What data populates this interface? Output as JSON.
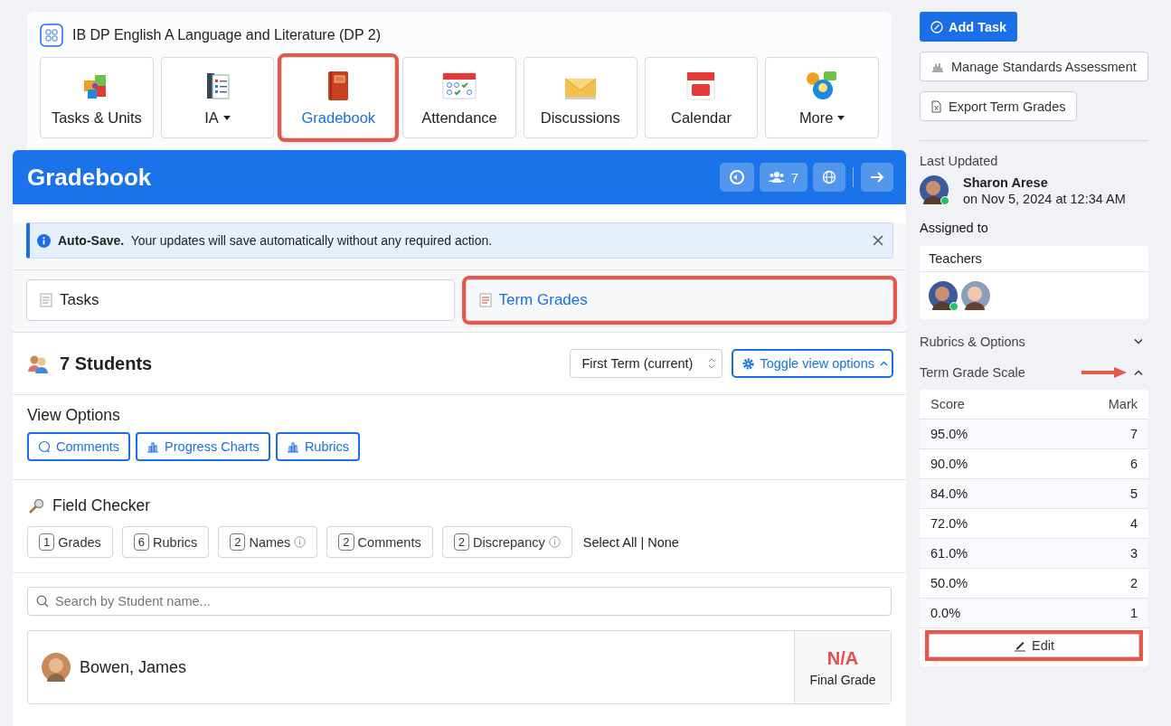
{
  "course": {
    "title": "IB DP English A Language and Literature (DP 2)"
  },
  "nav": [
    {
      "label": "Tasks & Units",
      "selected": false,
      "dropdown": false,
      "highlighted": false
    },
    {
      "label": "IA",
      "selected": false,
      "dropdown": true,
      "highlighted": false
    },
    {
      "label": "Gradebook",
      "selected": true,
      "dropdown": false,
      "highlighted": true
    },
    {
      "label": "Attendance",
      "selected": false,
      "dropdown": false,
      "highlighted": false
    },
    {
      "label": "Discussions",
      "selected": false,
      "dropdown": false,
      "highlighted": false
    },
    {
      "label": "Calendar",
      "selected": false,
      "dropdown": false,
      "highlighted": false
    },
    {
      "label": "More",
      "selected": false,
      "dropdown": true,
      "highlighted": false
    }
  ],
  "gradebook": {
    "title": "Gradebook",
    "member_count": "7",
    "notice": {
      "text": "**Auto-Save.**  Your updates will save automatically without any required action."
    },
    "tabs": [
      {
        "label": "Tasks",
        "selected": false,
        "highlighted": false
      },
      {
        "label": "Term Grades",
        "selected": true,
        "highlighted": true
      }
    ],
    "students_heading": "7 Students",
    "term_select": {
      "value": "First Term (current)"
    },
    "toggle_button": "Toggle view options",
    "view_options": {
      "heading": "View Options",
      "buttons": [
        "Comments",
        "Progress Charts",
        "Rubrics"
      ]
    },
    "field_checker": {
      "heading": "Field Checker",
      "chips": [
        {
          "count": "1",
          "label": "Grades",
          "info": false
        },
        {
          "count": "6",
          "label": "Rubrics",
          "info": false
        },
        {
          "count": "2",
          "label": "Names",
          "info": true
        },
        {
          "count": "2",
          "label": "Comments",
          "info": false
        },
        {
          "count": "2",
          "label": "Discrepancy",
          "info": true
        }
      ],
      "select_all": "Select All",
      "separator": "|",
      "none": "None"
    },
    "search": {
      "placeholder": "Search by Student name..."
    },
    "student": {
      "name": "Bowen, James",
      "grade": "N/A",
      "grade_label": "Final Grade"
    }
  },
  "sidebar": {
    "buttons": [
      "Add Task",
      "Manage Standards Assessment",
      "Export Term Grades"
    ],
    "last_updated": {
      "heading": "Last Updated",
      "name": "Sharon Arese",
      "date": "on Nov 5, 2024 at 12:34 AM",
      "online": true
    },
    "assigned": {
      "heading": "Assigned to",
      "group": "Teachers",
      "teachers": [
        {
          "online": true
        },
        {
          "online": false
        }
      ]
    },
    "sections": [
      {
        "title": "Rubrics & Options",
        "expanded": false,
        "pointed": false
      },
      {
        "title": "Term Grade Scale",
        "expanded": true,
        "pointed": true
      }
    ],
    "scale": {
      "columns": [
        "Score",
        "Mark"
      ],
      "rows": [
        [
          "95.0%",
          "7"
        ],
        [
          "90.0%",
          "6"
        ],
        [
          "84.0%",
          "5"
        ],
        [
          "72.0%",
          "4"
        ],
        [
          "61.0%",
          "3"
        ],
        [
          "50.0%",
          "2"
        ],
        [
          "0.0%",
          "1"
        ]
      ],
      "edit": "Edit",
      "edit_highlighted": true
    }
  }
}
